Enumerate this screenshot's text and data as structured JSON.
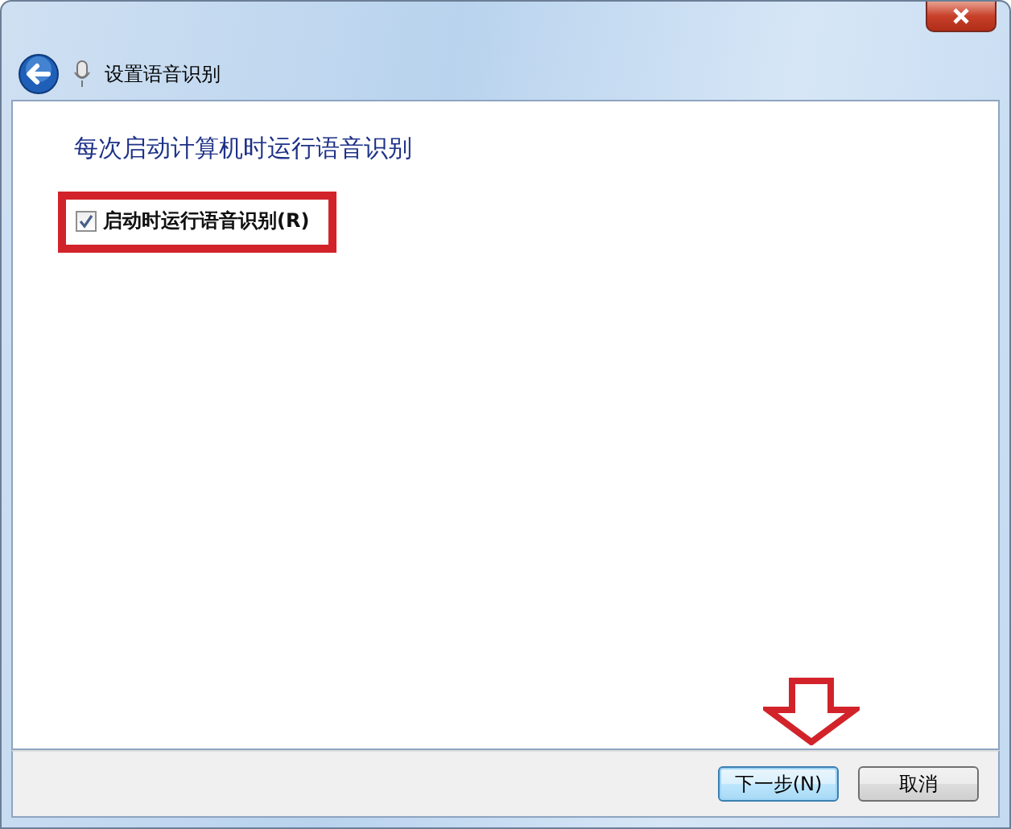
{
  "window": {
    "title": "设置语音识别"
  },
  "heading": "每次启动计算机时运行语音识别",
  "option": {
    "label": "启动时运行语音识别(R)",
    "checked": true
  },
  "buttons": [
    {
      "label": "下一步(N)",
      "kind": "default"
    },
    {
      "label": "取消",
      "kind": "normal"
    }
  ]
}
